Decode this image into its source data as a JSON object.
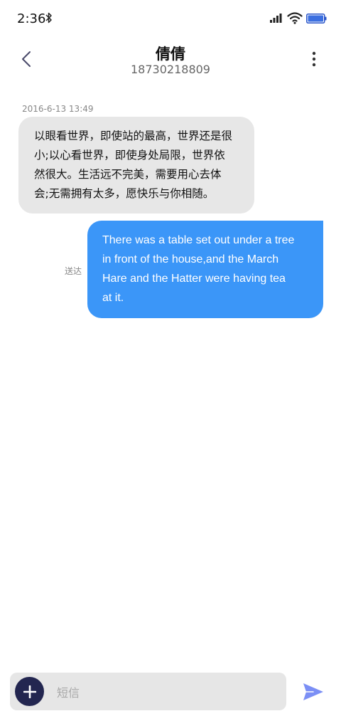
{
  "status_bar": {
    "time": "2:36",
    "icons": [
      "bluetooth-icon",
      "signal-icon",
      "wifi-icon",
      "battery-icon"
    ]
  },
  "header": {
    "contact_name": "倩倩",
    "contact_number": "18730218809",
    "icons": [
      "back-arrow-icon",
      "more-vertical-icon"
    ]
  },
  "conversation": {
    "timestamp": "2016-6-13 13:49",
    "incoming": {
      "lines": [
        "以眼看世界，即使站的最高，世界还是很",
        "小;以心看世界，即使身处局限，世界依",
        "然很大。生活远不完美，需要用心去体",
        "会;无需拥有太多，愿快乐与你相随。"
      ]
    },
    "outgoing": {
      "lines": [
        "There was a table set out under a tree",
        "in front of the house,and the March",
        "Hare and the Hatter were having tea",
        "at it."
      ],
      "status": "送达"
    }
  },
  "composer": {
    "placeholder": "短信",
    "value": "",
    "icons": [
      "plus-icon",
      "send-icon"
    ]
  },
  "colors": {
    "outgoing_bubble": "#3b96f8",
    "incoming_bubble": "#e7e7e7",
    "add_button": "#232650",
    "send_icon": "#7b8ff5"
  }
}
